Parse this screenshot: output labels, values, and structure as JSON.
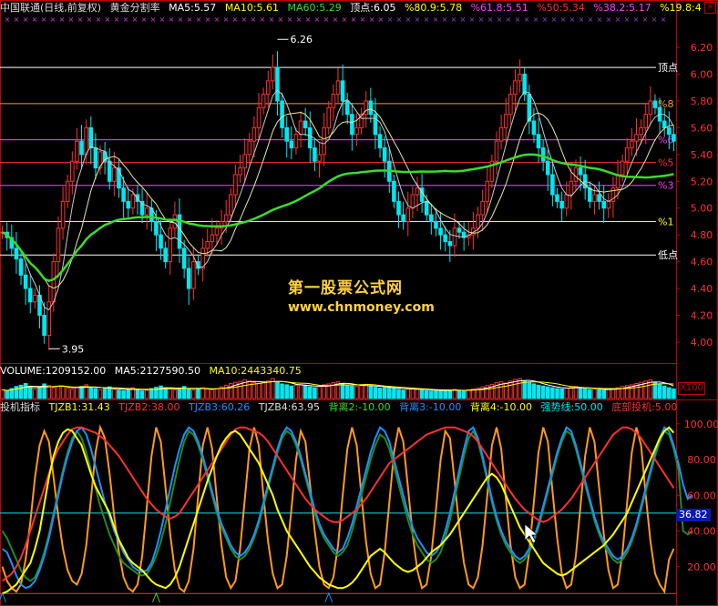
{
  "window": {
    "close_glyph": "×"
  },
  "main_header": {
    "title": "中国联通(日线,前复权)",
    "indicator": "黄金分割率",
    "ma5": "MA5:5.57",
    "ma10": "MA10:5.61",
    "ma60": "MA60:5.29",
    "top": "顶点:6.05",
    "p80": "%80.9:5.78",
    "p61": "%61.8:5.51",
    "p50": "%50:5.34",
    "p38": "%38.2:5.17",
    "p19": "%19.8:4"
  },
  "vol_header": {
    "vol": "VOLUME:1209152.00",
    "ma5": "MA5:2127590.50",
    "ma10": "MA10:2443340.75"
  },
  "ind_header": {
    "name": "投机指标",
    "tjzb1": "TJZB1:31.43",
    "tjzb2": "TJZB2:38.00",
    "tjzb3": "TJZB3:60.26",
    "tjzb4": "TJZB4:63.95",
    "bl2": "背离2:-10.00",
    "bl3": "背离3:-10.00",
    "bl4": "背离4:-10.00",
    "qsx": "强势线:50.00",
    "dbtj": "底部投机:5.00"
  },
  "watermark": {
    "line1": "第一股票公式网",
    "line2": "www.chnmoney.com"
  },
  "vol_scale": "X100",
  "current_value": "36.82",
  "colors": {
    "red": "#ff3030",
    "cyan": "#00e8f0",
    "white": "#ffffff",
    "yellow": "#ffff00",
    "green": "#3adc2a",
    "magenta": "#ff40ff",
    "gray": "#c8c8c8",
    "frame": "#c00000"
  },
  "chart_data": [
    {
      "type": "candlestick",
      "ylim": [
        3.85,
        6.35
      ],
      "yticks": [
        4.0,
        4.2,
        4.4,
        4.6,
        4.8,
        5.0,
        5.2,
        5.4,
        5.6,
        5.8,
        6.0,
        6.2
      ],
      "level_lines": [
        {
          "label": "顶点",
          "value": 6.05
        },
        {
          "label": "%8",
          "value": 5.78
        },
        {
          "label": "%6",
          "value": 5.51
        },
        {
          "label": "%5",
          "value": 5.34
        },
        {
          "label": "%3",
          "value": 5.17
        },
        {
          "label": "%1",
          "value": 4.9
        },
        {
          "label": "低点",
          "value": 4.65
        }
      ],
      "annotations": [
        {
          "label": "6.26",
          "value": 6.26
        },
        {
          "label": "3.95",
          "value": 3.95
        }
      ],
      "close": [
        4.82,
        4.78,
        4.7,
        4.62,
        4.5,
        4.4,
        4.3,
        4.35,
        4.2,
        4.05,
        4.3,
        4.6,
        4.85,
        5.05,
        5.2,
        5.35,
        5.5,
        5.4,
        5.6,
        5.45,
        5.3,
        5.42,
        5.35,
        5.2,
        5.3,
        5.15,
        5.05,
        5.0,
        5.1,
        5.05,
        4.95,
        5.0,
        4.9,
        4.8,
        4.7,
        4.6,
        4.85,
        4.95,
        4.7,
        4.55,
        4.4,
        4.6,
        4.55,
        4.7,
        4.75,
        4.8,
        4.85,
        4.9,
        4.95,
        5.1,
        5.25,
        5.3,
        5.4,
        5.5,
        5.6,
        5.75,
        5.85,
        5.95,
        6.05,
        5.8,
        5.6,
        5.5,
        5.45,
        5.55,
        5.65,
        5.6,
        5.45,
        5.35,
        5.4,
        5.6,
        5.75,
        5.85,
        5.95,
        5.8,
        5.7,
        5.55,
        5.6,
        5.7,
        5.8,
        5.7,
        5.55,
        5.45,
        5.35,
        5.2,
        5.05,
        4.95,
        4.9,
        5.0,
        5.1,
        5.15,
        5.05,
        4.95,
        4.9,
        4.85,
        4.8,
        4.75,
        4.72,
        4.85,
        4.82,
        4.78,
        4.8,
        4.85,
        4.95,
        5.05,
        5.2,
        5.35,
        5.5,
        5.6,
        5.7,
        5.85,
        5.95,
        6.0,
        5.85,
        5.65,
        5.55,
        5.45,
        5.35,
        5.25,
        5.1,
        5.05,
        5.0,
        5.1,
        5.2,
        5.3,
        5.25,
        5.15,
        5.05,
        5.1,
        5.05,
        5.0,
        5.05,
        5.15,
        5.25,
        5.35,
        5.45,
        5.5,
        5.55,
        5.6,
        5.7,
        5.8,
        5.75,
        5.65,
        5.6,
        5.55,
        5.5
      ]
    },
    {
      "type": "bar",
      "name": "VOLUME",
      "values": [
        2.1,
        1.8,
        2.4,
        2.9,
        3.2,
        3.6,
        2.7,
        2.2,
        2.8,
        3.5,
        3.1,
        2.6,
        2.9,
        3.0,
        2.4,
        2.2,
        2.7,
        2.9,
        3.3,
        2.6,
        2.4,
        2.1,
        2.5,
        2.8,
        2.2,
        2.0,
        1.9,
        2.3,
        2.6,
        2.1,
        1.8,
        2.0,
        2.4,
        2.7,
        3.0,
        2.6,
        2.3,
        2.1,
        2.5,
        2.9,
        2.2,
        2.0,
        2.4,
        2.6,
        2.3,
        2.1,
        2.4,
        2.8,
        3.2,
        3.6,
        3.9,
        4.1,
        4.5,
        4.2,
        3.8,
        3.6,
        3.9,
        4.2,
        4.8,
        4.0,
        3.5,
        3.3,
        3.0,
        3.2,
        3.4,
        3.1,
        2.8,
        2.6,
        2.9,
        3.3,
        3.5,
        3.8,
        4.0,
        3.6,
        3.2,
        3.0,
        2.9,
        3.1,
        3.4,
        3.0,
        2.7,
        2.5,
        2.6,
        2.8,
        2.4,
        2.2,
        2.0,
        2.3,
        2.5,
        2.2,
        2.0,
        1.9,
        1.8,
        2.1,
        2.0,
        1.9,
        1.8,
        2.2,
        2.0,
        1.9,
        2.1,
        2.3,
        2.5,
        2.8,
        3.1,
        3.4,
        3.8,
        4.0,
        3.7,
        4.2,
        4.6,
        4.8,
        4.3,
        3.9,
        3.5,
        3.2,
        3.0,
        2.8,
        2.6,
        2.4,
        2.3,
        2.5,
        2.7,
        2.9,
        2.6,
        2.4,
        2.2,
        2.3,
        2.1,
        2.0,
        2.2,
        2.4,
        2.6,
        2.9,
        3.1,
        3.3,
        3.6,
        3.9,
        4.2,
        4.5,
        3.8,
        3.4,
        3.0,
        2.6,
        2.3
      ]
    },
    {
      "type": "line",
      "name": "投机指标",
      "ylim": [
        0,
        105
      ],
      "yticks": [
        20,
        40,
        60,
        80,
        100
      ],
      "strong_line": 50,
      "bottom_line": 5,
      "series": [
        {
          "name": "TJZB1",
          "color": "#ffff00",
          "values": [
            5,
            6,
            8,
            10,
            14,
            18,
            22,
            30,
            40,
            55,
            70,
            82,
            90,
            95,
            97,
            96,
            92,
            88,
            80,
            72,
            65,
            60,
            55,
            50,
            42,
            35,
            30,
            25,
            22,
            20,
            18,
            15,
            12,
            10,
            9,
            8,
            10,
            14,
            20,
            28,
            36,
            44,
            52,
            60,
            68,
            75,
            82,
            88,
            92,
            95,
            96,
            94,
            90,
            86,
            82,
            78,
            72,
            66,
            60,
            52,
            46,
            40,
            36,
            32,
            28,
            24,
            20,
            17,
            14,
            12,
            10,
            9,
            8,
            8,
            9,
            11,
            14,
            18,
            22,
            26,
            28,
            30,
            28,
            25,
            22,
            20,
            18,
            17,
            18,
            20,
            22,
            25,
            28,
            30,
            32,
            35,
            38,
            42,
            46,
            50,
            54,
            58,
            62,
            66,
            70,
            72,
            70,
            66,
            60,
            54,
            48,
            42,
            38,
            34,
            30,
            26,
            22,
            20,
            18,
            16,
            15,
            16,
            18,
            20,
            22,
            24,
            26,
            28,
            30,
            32,
            35,
            38,
            42,
            46,
            50,
            56,
            62,
            68,
            74,
            80,
            86,
            92,
            96,
            98,
            95
          ]
        },
        {
          "name": "TJZB2",
          "color": "#ff3030",
          "values": [
            12,
            14,
            16,
            20,
            25,
            32,
            40,
            48,
            56,
            64,
            72,
            80,
            86,
            90,
            94,
            97,
            98,
            98,
            97,
            96,
            95,
            93,
            91,
            88,
            85,
            82,
            78,
            74,
            70,
            66,
            62,
            58,
            55,
            52,
            50,
            48,
            47,
            48,
            50,
            54,
            58,
            62,
            66,
            70,
            74,
            78,
            82,
            86,
            90,
            94,
            97,
            98,
            98,
            97,
            96,
            95,
            93,
            90,
            86,
            82,
            78,
            74,
            70,
            66,
            62,
            58,
            55,
            52,
            50,
            48,
            46,
            45,
            45,
            46,
            48,
            50,
            52,
            55,
            58,
            62,
            66,
            70,
            74,
            78,
            80,
            82,
            84,
            86,
            88,
            90,
            92,
            94,
            95,
            96,
            97,
            98,
            98,
            98,
            97,
            96,
            95,
            93,
            90,
            86,
            82,
            78,
            74,
            70,
            66,
            62,
            58,
            55,
            52,
            50,
            48,
            46,
            45,
            46,
            48,
            50,
            52,
            55,
            58,
            62,
            66,
            70,
            74,
            78,
            82,
            86,
            90,
            94,
            96,
            98,
            98,
            97,
            95,
            92,
            88,
            84,
            80,
            76,
            72,
            68,
            64
          ]
        },
        {
          "name": "TJZB3",
          "color": "#1e90ff",
          "values": [
            30,
            28,
            22,
            15,
            10,
            8,
            9,
            12,
            18,
            26,
            36,
            48,
            60,
            72,
            82,
            90,
            96,
            98,
            94,
            86,
            76,
            66,
            56,
            48,
            40,
            34,
            28,
            24,
            20,
            18,
            17,
            18,
            22,
            30,
            40,
            52,
            64,
            76,
            86,
            94,
            98,
            96,
            90,
            82,
            72,
            62,
            52,
            44,
            38,
            32,
            28,
            26,
            28,
            32,
            38,
            46,
            56,
            66,
            76,
            86,
            94,
            98,
            96,
            90,
            82,
            72,
            62,
            52,
            44,
            38,
            34,
            30,
            28,
            30,
            36,
            44,
            54,
            64,
            74,
            84,
            92,
            98,
            96,
            90,
            80,
            70,
            60,
            50,
            42,
            36,
            32,
            28,
            26,
            28,
            32,
            40,
            50,
            62,
            74,
            86,
            96,
            98,
            92,
            82,
            70,
            58,
            48,
            40,
            34,
            30,
            26,
            24,
            26,
            30,
            36,
            44,
            54,
            64,
            74,
            84,
            92,
            98,
            96,
            88,
            78,
            68,
            58,
            48,
            40,
            34,
            30,
            26,
            24,
            26,
            30,
            36,
            44,
            54,
            64,
            74,
            84,
            92,
            98,
            96,
            88,
            78,
            66,
            58,
            60
          ]
        },
        {
          "name": "TJZB4",
          "color": "#228b22",
          "values": [
            40,
            36,
            30,
            24,
            18,
            14,
            12,
            14,
            20,
            28,
            38,
            50,
            62,
            74,
            84,
            92,
            96,
            92,
            84,
            74,
            64,
            54,
            46,
            38,
            32,
            26,
            22,
            20,
            18,
            16,
            15,
            16,
            20,
            26,
            34,
            44,
            56,
            68,
            80,
            90,
            96,
            94,
            88,
            80,
            70,
            60,
            50,
            42,
            36,
            30,
            26,
            24,
            26,
            30,
            36,
            44,
            54,
            64,
            74,
            84,
            92,
            96,
            94,
            88,
            80,
            70,
            60,
            50,
            42,
            36,
            32,
            28,
            26,
            28,
            32,
            40,
            50,
            60,
            70,
            80,
            88,
            94,
            92,
            86,
            76,
            66,
            56,
            46,
            38,
            32,
            28,
            24,
            22,
            24,
            28,
            36,
            46,
            58,
            70,
            82,
            92,
            96,
            90,
            80,
            68,
            56,
            46,
            38,
            32,
            28,
            24,
            22,
            24,
            28,
            34,
            42,
            52,
            62,
            72,
            82,
            90,
            96,
            94,
            86,
            76,
            66,
            56,
            46,
            38,
            32,
            28,
            24,
            22,
            24,
            28,
            34,
            42,
            52,
            62,
            72,
            82,
            90,
            96,
            94,
            86,
            74,
            40,
            38,
            40
          ]
        },
        {
          "name": "orange",
          "color": "#ff9a1a",
          "values": [
            20,
            12,
            8,
            6,
            10,
            24,
            45,
            70,
            88,
            96,
            90,
            70,
            48,
            30,
            18,
            12,
            10,
            16,
            32,
            58,
            84,
            98,
            92,
            72,
            48,
            28,
            14,
            8,
            6,
            10,
            26,
            54,
            82,
            98,
            90,
            64,
            38,
            18,
            8,
            6,
            12,
            30,
            60,
            88,
            98,
            86,
            58,
            32,
            14,
            8,
            12,
            30,
            58,
            86,
            98,
            88,
            60,
            34,
            16,
            8,
            10,
            26,
            52,
            80,
            96,
            90,
            66,
            40,
            20,
            10,
            8,
            14,
            32,
            60,
            86,
            98,
            88,
            60,
            34,
            16,
            8,
            10,
            28,
            56,
            84,
            98,
            90,
            64,
            38,
            18,
            8,
            10,
            26,
            52,
            80,
            96,
            92,
            68,
            42,
            22,
            10,
            8,
            14,
            32,
            60,
            88,
            98,
            86,
            58,
            32,
            14,
            8,
            10,
            28,
            56,
            84,
            98,
            90,
            62,
            36,
            16,
            8,
            10,
            26,
            54,
            82,
            98,
            90,
            64,
            38,
            18,
            8,
            10,
            28,
            56,
            84,
            98,
            88,
            60,
            34,
            16,
            10,
            6,
            24,
            30
          ]
        }
      ]
    }
  ]
}
